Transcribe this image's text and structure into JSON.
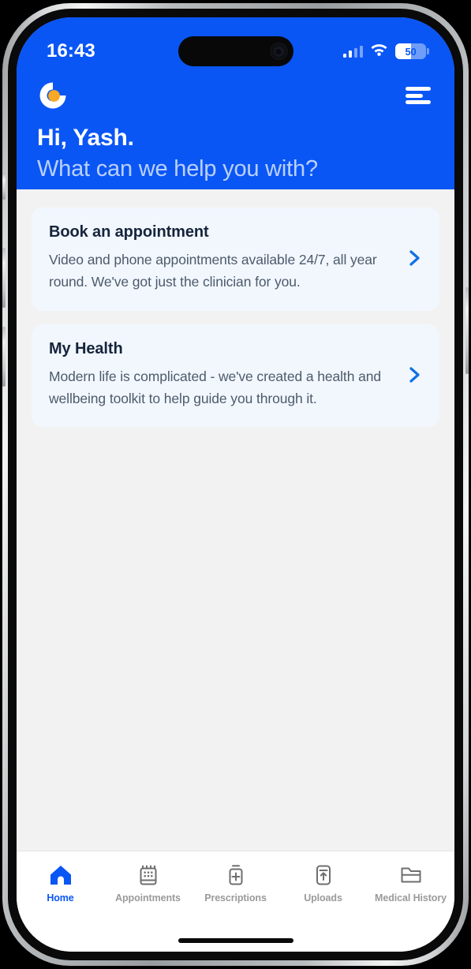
{
  "status_bar": {
    "time": "16:43",
    "battery_percent": "50",
    "battery_level": 50,
    "signal_icon": "cellular-signal-icon",
    "wifi_icon": "wifi-icon",
    "battery_icon": "battery-icon"
  },
  "header": {
    "logo_icon": "app-logo-icon",
    "menu_icon": "hamburger-menu-icon",
    "greeting": "Hi, Yash.",
    "subgreeting": "What can we help you with?",
    "background_color": "#0a56f5"
  },
  "cards": [
    {
      "title": "Book an appointment",
      "description": "Video and phone appointments available 24/7, all year round. We've got just the clinician for you.",
      "chevron_icon": "chevron-right-icon"
    },
    {
      "title": "My Health",
      "description": "Modern life is complicated - we've created a health and wellbeing toolkit to help guide you through it.",
      "chevron_icon": "chevron-right-icon"
    }
  ],
  "bottom_nav": {
    "items": [
      {
        "label": "Home",
        "icon": "home-icon",
        "active": true
      },
      {
        "label": "Appointments",
        "icon": "calendar-icon",
        "active": false
      },
      {
        "label": "Prescriptions",
        "icon": "pill-bottle-icon",
        "active": false
      },
      {
        "label": "Uploads",
        "icon": "upload-device-icon",
        "active": false
      },
      {
        "label": "Medical History",
        "icon": "folder-icon",
        "active": false
      }
    ],
    "active_color": "#0a56f5",
    "inactive_color": "#9a9a9a"
  },
  "colors": {
    "brand_blue": "#0a56f5",
    "logo_accent": "#f9a825",
    "card_bg": "#f1f7fd",
    "page_bg": "#f2f2f2",
    "card_title": "#16243c",
    "card_desc": "#4e5a6b"
  }
}
